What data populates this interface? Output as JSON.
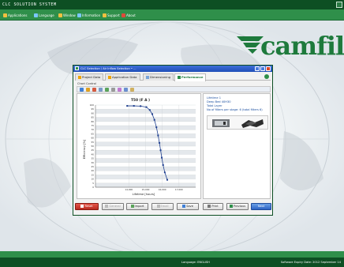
{
  "app": {
    "title": "CLC SOLUTION SYSTEM",
    "menu": [
      {
        "label": "Applications",
        "icon": "apps-icon"
      },
      {
        "label": "Language",
        "icon": "language-icon"
      },
      {
        "label": "Window",
        "icon": "window-icon"
      },
      {
        "label": "Information",
        "icon": "info-icon"
      },
      {
        "label": "Support",
        "icon": "support-icon"
      },
      {
        "label": "About",
        "icon": "about-icon"
      }
    ]
  },
  "brand": {
    "name": "camfil",
    "color": "#1e7a3c"
  },
  "window": {
    "title": "CLC Selection / Air Inflow Selection • ...",
    "tabs": [
      {
        "label": "Project Data",
        "active": false
      },
      {
        "label": "Application Data",
        "active": false
      },
      {
        "label": "Dimensioning",
        "active": false
      },
      {
        "label": "Performance",
        "active": true
      }
    ],
    "chart_control_label": "Chart Control"
  },
  "info": {
    "lines": [
      "Lifetime 1",
      "Deep Bed 40H30",
      "Total Layer",
      "No of filters per stage: 6 (total filters 6)"
    ]
  },
  "footer": {
    "reset": "Reset",
    "general": "General",
    "import": "Import",
    "email": "Email",
    "save": "Save",
    "print": "Print",
    "previous": "Previous",
    "next": "Next"
  },
  "status": {
    "language": "Language: ENGLISH",
    "info": "Software Expiry Date: 2012 September 14"
  },
  "colors": {
    "primary_green": "#2f8f4a",
    "dark_green": "#0d4f23",
    "window_title_blue": "#1f4eb8",
    "reset_red": "#c0392b",
    "next_blue": "#2d63c3",
    "series_color": "#1f3f8f"
  },
  "chart_data": {
    "type": "line",
    "title": "T50 (F A )",
    "xlabel": "Lifetime [hours]",
    "ylabel": "Efficiency [%]",
    "xlim": [
      12000,
      18000
    ],
    "ylim": [
      0,
      100
    ],
    "x_ticks": [
      "14,000",
      "15,000",
      "16,000",
      "17,000"
    ],
    "x_tick_values": [
      14000,
      15000,
      16000,
      17000
    ],
    "y_ticks": [
      0,
      5,
      10,
      15,
      20,
      25,
      30,
      35,
      40,
      45,
      50,
      55,
      60,
      65,
      70,
      75,
      80,
      85,
      90,
      95,
      100
    ],
    "grid": true,
    "series": [
      {
        "x": [
          13900,
          14300,
          14700,
          15050,
          15250,
          15400,
          15530,
          15650,
          15750,
          15830,
          15900,
          15970,
          16050,
          16150,
          16300
        ],
        "y": [
          99,
          99,
          98.7,
          97.5,
          94,
          89,
          82,
          73,
          63,
          54,
          45,
          36,
          27,
          18,
          9
        ]
      }
    ]
  }
}
